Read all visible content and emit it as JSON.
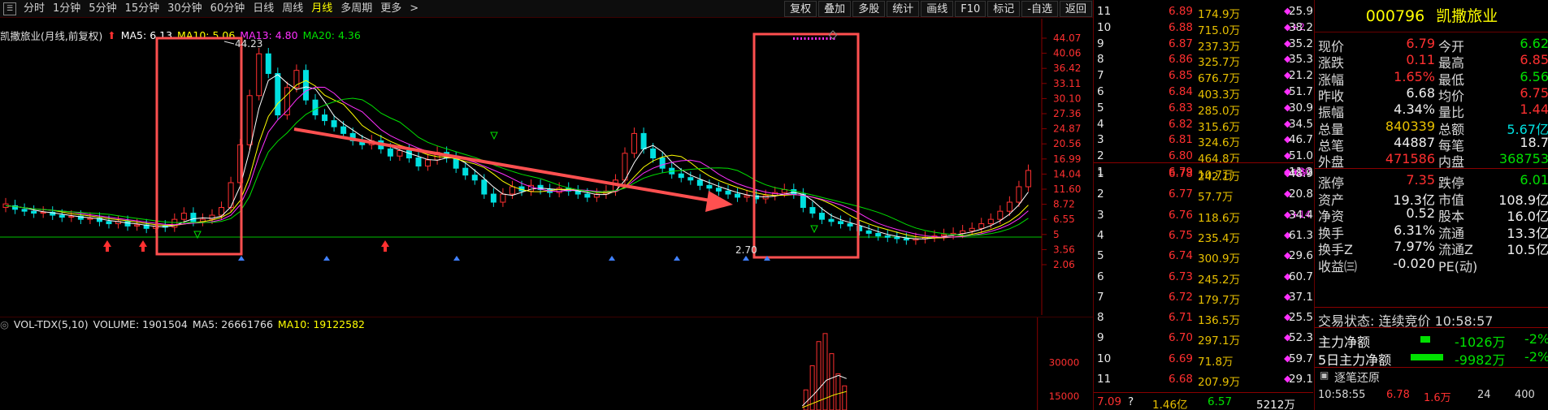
{
  "toolbar": {
    "periods": [
      "分时",
      "1分钟",
      "5分钟",
      "15分钟",
      "30分钟",
      "60分钟",
      "日线",
      "周线",
      "月线",
      "多周期",
      "更多"
    ],
    "active_period": "月线",
    "more_suffix": ">",
    "right_buttons": [
      "复权",
      "叠加",
      "多股",
      "统计",
      "画线",
      "F10",
      "标记",
      "-自选",
      "返回"
    ]
  },
  "main_info": {
    "title": "凯撒旅业(月线,前复权)",
    "ma5": "MA5: 6.13",
    "ma10": "MA10: 5.06",
    "ma13": "MA13: 4.80",
    "ma20": "MA20: 4.36",
    "colors": {
      "ma5": "#ffffff",
      "ma10": "#ffff00",
      "ma13": "#ff30ff",
      "ma20": "#00e000"
    }
  },
  "axis": {
    "price_ticks": [
      "44.07",
      "40.06",
      "36.42",
      "33.11",
      "30.10",
      "27.36",
      "24.87",
      "20.56",
      "16.99",
      "14.04",
      "11.60",
      "8.72",
      "6.55",
      "5",
      "3.56",
      "2.06"
    ],
    "vol_ticks": [
      "30000",
      "15000"
    ]
  },
  "annotations": {
    "high_label": "44.23",
    "low_label": "2.70"
  },
  "chart_data": {
    "type": "candlestick",
    "description_values": {
      "high": 44.23,
      "low": 2.7
    },
    "price_axis_ticks": [
      44.07,
      40.06,
      36.42,
      33.11,
      30.1,
      27.36,
      24.87,
      20.56,
      16.99,
      14.04,
      11.6,
      8.72,
      6.55,
      5,
      3.56,
      2.06
    ],
    "moving_averages": {
      "MA5": 6.13,
      "MA10": 5.06,
      "MA13": 4.8,
      "MA20": 4.36
    }
  },
  "volume_info": {
    "label": "VOL-TDX(5,10)",
    "volume": "VOLUME: 1901504",
    "ma5": "MA5: 26661766",
    "ma10": "MA10: 19122582"
  },
  "order_book": {
    "asks": [
      {
        "level": "11",
        "price": "6.89",
        "vol": "174.9万",
        "mark": "◆",
        "pct": "25.9"
      },
      {
        "level": "10",
        "price": "6.88",
        "vol": "715.0万",
        "mark": "◆+2",
        "pct": "38.2"
      },
      {
        "level": "9",
        "price": "6.87",
        "vol": "237.3万",
        "mark": "◆",
        "pct": "35.2"
      },
      {
        "level": "8",
        "price": "6.86",
        "vol": "325.7万",
        "mark": "◆",
        "pct": "35.3"
      },
      {
        "level": "7",
        "price": "6.85",
        "vol": "676.7万",
        "mark": "◆",
        "pct": "21.2"
      },
      {
        "level": "6",
        "price": "6.84",
        "vol": "403.3万",
        "mark": "◆",
        "pct": "51.7"
      },
      {
        "level": "5",
        "price": "6.83",
        "vol": "285.0万",
        "mark": "◆",
        "pct": "30.9"
      },
      {
        "level": "4",
        "price": "6.82",
        "vol": "315.6万",
        "mark": "◆",
        "pct": "34.5"
      },
      {
        "level": "3",
        "price": "6.81",
        "vol": "324.6万",
        "mark": "◆",
        "pct": "46.7"
      },
      {
        "level": "2",
        "price": "6.80",
        "vol": "464.8万",
        "mark": "◆",
        "pct": "51.0"
      },
      {
        "level": "1",
        "price": "6.79",
        "vol": "10.7万",
        "mark": "◆+30",
        "pct": "11.2"
      }
    ],
    "bids": [
      {
        "level": "1",
        "price": "6.78",
        "vol": "242.1万",
        "mark": "◆-65",
        "pct": "48.9"
      },
      {
        "level": "2",
        "price": "6.77",
        "vol": "57.7万",
        "mark": "◆",
        "pct": "20.8"
      },
      {
        "level": "3",
        "price": "6.76",
        "vol": "118.6万",
        "mark": "◆+14",
        "pct": "34.4"
      },
      {
        "level": "4",
        "price": "6.75",
        "vol": "235.4万",
        "mark": "◆",
        "pct": "61.3"
      },
      {
        "level": "5",
        "price": "6.74",
        "vol": "300.9万",
        "mark": "◆",
        "pct": "29.6"
      },
      {
        "level": "6",
        "price": "6.73",
        "vol": "245.2万",
        "mark": "◆",
        "pct": "60.7"
      },
      {
        "level": "7",
        "price": "6.72",
        "vol": "179.7万",
        "mark": "◆",
        "pct": "37.1"
      },
      {
        "level": "8",
        "price": "6.71",
        "vol": "136.5万",
        "mark": "◆",
        "pct": "25.5"
      },
      {
        "level": "9",
        "price": "6.70",
        "vol": "297.1万",
        "mark": "◆",
        "pct": "52.3"
      },
      {
        "level": "10",
        "price": "6.69",
        "vol": "71.8万",
        "mark": "◆",
        "pct": "59.7"
      },
      {
        "level": "11",
        "price": "6.68",
        "vol": "207.9万",
        "mark": "◆",
        "pct": "29.1"
      }
    ],
    "bottom": {
      "price": "7.09",
      "q": "?",
      "amount": "1.46亿",
      "val": "6.57",
      "vol": "5212万"
    }
  },
  "quote": {
    "code": "000796",
    "name": "凯撒旅业",
    "rows": [
      {
        "l1": "现价",
        "v1": "6.79",
        "c1": "red",
        "l2": "今开",
        "v2": "6.62",
        "c2": "green"
      },
      {
        "l1": "涨跌",
        "v1": "0.11",
        "c1": "red",
        "l2": "最高",
        "v2": "6.85",
        "c2": "red"
      },
      {
        "l1": "涨幅",
        "v1": "1.65%",
        "c1": "red",
        "l2": "最低",
        "v2": "6.56",
        "c2": "green"
      },
      {
        "l1": "昨收",
        "v1": "6.68",
        "c1": "white",
        "l2": "均价",
        "v2": "6.75",
        "c2": "red"
      },
      {
        "l1": "振幅",
        "v1": "4.34%",
        "c1": "white",
        "l2": "量比",
        "v2": "1.44",
        "c2": "red"
      },
      {
        "l1": "总量",
        "v1": "840339",
        "c1": "gold",
        "l2": "总额",
        "v2": "5.67亿",
        "c2": "cyan"
      },
      {
        "l1": "总笔",
        "v1": "44887",
        "c1": "white",
        "l2": "每笔",
        "v2": "18.7",
        "c2": "white"
      },
      {
        "l1": "外盘",
        "v1": "471586",
        "c1": "red",
        "l2": "内盘",
        "v2": "368753",
        "c2": "green"
      }
    ],
    "rows2": [
      {
        "l1": "涨停",
        "v1": "7.35",
        "c1": "red",
        "l2": "跌停",
        "v2": "6.01",
        "c2": "green"
      },
      {
        "l1": "资产",
        "v1": "19.3亿",
        "c1": "white",
        "l2": "市值",
        "v2": "108.9亿",
        "c2": "white"
      },
      {
        "l1": "净资",
        "v1": "0.52",
        "c1": "white",
        "l2": "股本",
        "v2": "16.0亿",
        "c2": "white"
      },
      {
        "l1": "换手",
        "v1": "6.31%",
        "c1": "white",
        "l2": "流通",
        "v2": "13.3亿",
        "c2": "white"
      },
      {
        "l1": "换手Z",
        "v1": "7.97%",
        "c1": "white",
        "l2": "流通Z",
        "v2": "10.5亿",
        "c2": "white"
      },
      {
        "l1": "收益㈢",
        "v1": "-0.020",
        "c1": "white",
        "l2": "PE(动)",
        "v2": "",
        "c2": "white"
      }
    ],
    "status": "交易状态: 连续竞价 10:58:57",
    "flow": [
      {
        "label": "主力净额",
        "value": "-1026万",
        "pct": "-2%"
      },
      {
        "label": "5日主力净额",
        "value": "-9982万",
        "pct": "-2%"
      }
    ],
    "ticks_header": "逐笔还原",
    "tick": {
      "time": "10:58:55",
      "price": "6.78",
      "vol": "1.6万",
      "b": "24",
      "c": "400"
    }
  },
  "colors": {
    "up": "#ff3030",
    "down": "#00e0e0",
    "highlight_box": "#ff5050",
    "arrow": "#ff5050"
  }
}
